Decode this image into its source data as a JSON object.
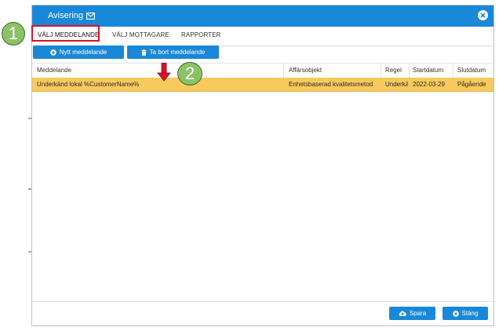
{
  "dialog": {
    "title": "Avisering",
    "close_label": "×"
  },
  "tabs": [
    {
      "label": "VÄLJ MEDDELANDE",
      "active": true
    },
    {
      "label": "VÄLJ MOTTAGARE",
      "active": false
    },
    {
      "label": "RAPPORTER",
      "active": false
    }
  ],
  "toolbar": {
    "new_label": "Nytt meddelande",
    "delete_label": "Ta bort meddelande"
  },
  "table": {
    "columns": [
      "Meddelande",
      "Affärsobjekt",
      "Regel",
      "Startdatum",
      "Slutdatum"
    ],
    "rows": [
      {
        "message": "Underkänd lokal %CustomerName%",
        "object": "Enhetsbaserad kvalitetsmetod",
        "rule": "Underkänd",
        "start": "2022-03-29",
        "end": "Pågående"
      }
    ]
  },
  "footer": {
    "save_label": "Spara",
    "close_label": "Stäng"
  },
  "annotations": {
    "marker1": "1",
    "marker2": "2"
  },
  "colors": {
    "accent": "#1a88d8",
    "selected_row": "#f8c95c",
    "highlight": "#e0102a",
    "marker": "#8bc267"
  }
}
